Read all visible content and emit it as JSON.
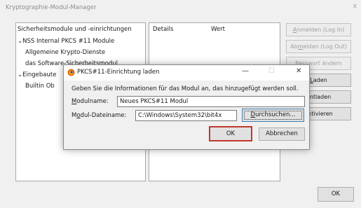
{
  "window": {
    "title": "Kryptographie-Modul-Manager",
    "close_glyph": "x"
  },
  "tree": {
    "header": "Sicherheitsmodule und -einrichtungen",
    "items": [
      {
        "label": "NSS Internal PKCS #11 Module",
        "expander": "⌄"
      },
      {
        "label": "Allgemeine Krypto-Dienste"
      },
      {
        "label": "das Software-Sicherheitsmodul"
      },
      {
        "label": "Eingebaute",
        "expander": "⌄"
      },
      {
        "label": "Builtin Ob"
      }
    ]
  },
  "details": {
    "columns": [
      "Details",
      "Wert"
    ]
  },
  "side_buttons": [
    {
      "prefix": "",
      "ul": "A",
      "rest": "nmelden (Log In)",
      "enabled": false
    },
    {
      "prefix": "Ab",
      "ul": "m",
      "rest": "elden (Log Out)",
      "enabled": false
    },
    {
      "prefix": "",
      "ul": "P",
      "rest": "asswort ändern",
      "enabled": false
    },
    {
      "prefix": "",
      "ul": "L",
      "rest": "aden",
      "enabled": true
    },
    {
      "prefix": "",
      "ul": "E",
      "rest": "ntladen",
      "enabled": true
    },
    {
      "prefix": "",
      "ul": "A",
      "rest": "ktivieren",
      "enabled": true
    }
  ],
  "ok_label": "OK",
  "dialog": {
    "title": "PKCS#11-Einrichtung laden",
    "icon": "firefox-icon",
    "controls": {
      "minimize": "—",
      "maximize": "☐",
      "close": "✕"
    },
    "prompt": "Geben Sie die Informationen für das Modul an, das hinzugefügt werden soll.",
    "module_name": {
      "label_ul": "M",
      "label_rest": "odulname:",
      "value": "Neues PKCS#11 Modul"
    },
    "module_file": {
      "label_pre": "M",
      "label_ul": "o",
      "label_rest": "dul-Dateiname:",
      "value": "C:\\Windows\\System32\\bit4x"
    },
    "browse": {
      "ul": "D",
      "rest": "urchsuchen..."
    },
    "ok_label": "OK",
    "cancel_label": "Abbrechen"
  }
}
